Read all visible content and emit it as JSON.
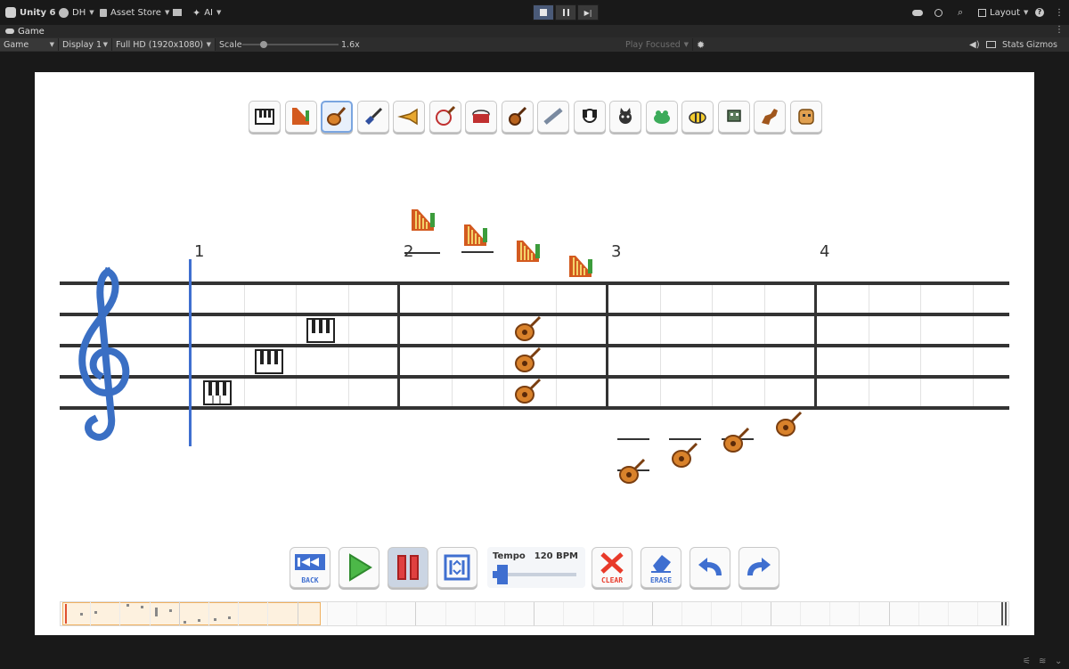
{
  "editor": {
    "unity_label": "Unity 6",
    "account_label": "DH",
    "asset_store_label": "Asset Store",
    "ai_label": "AI",
    "layout_label": "Layout",
    "game_tab_label": "Game",
    "game_view_dropdown": "Game",
    "display_dropdown": "Display 1",
    "resolution_dropdown": "Full HD (1920x1080)",
    "scale_label": "Scale",
    "scale_value": "1.6x",
    "play_focused_dropdown": "Play Focused",
    "stats_label": "Stats",
    "gizmos_label": "Gizmos"
  },
  "instruments": [
    {
      "name": "piano-icon",
      "selected": false
    },
    {
      "name": "harp-icon",
      "selected": false
    },
    {
      "name": "lute-icon",
      "selected": true
    },
    {
      "name": "electric-guitar-icon",
      "selected": false
    },
    {
      "name": "trumpet-icon",
      "selected": false
    },
    {
      "name": "banjo-icon",
      "selected": false
    },
    {
      "name": "drum-icon",
      "selected": false
    },
    {
      "name": "violin-icon",
      "selected": false
    },
    {
      "name": "flute-icon",
      "selected": false
    },
    {
      "name": "dog-icon",
      "selected": false
    },
    {
      "name": "cat-icon",
      "selected": false
    },
    {
      "name": "frog-icon",
      "selected": false
    },
    {
      "name": "bee-icon",
      "selected": false
    },
    {
      "name": "robot-icon",
      "selected": false
    },
    {
      "name": "dinosaur-icon",
      "selected": false
    },
    {
      "name": "ghost-icon",
      "selected": false
    }
  ],
  "score": {
    "measures": [
      "1",
      "2",
      "3",
      "4"
    ]
  },
  "controls": {
    "back_label": "BACK",
    "clear_label": "CLEAR",
    "erase_label": "ERASE",
    "tempo_label": "Tempo",
    "tempo_value": "120 BPM",
    "tempo_level_fraction": 0.12
  },
  "colors": {
    "accent_blue": "#3f6fd0",
    "clear_red": "#e83a2a",
    "pause_red": "#e04040",
    "play_green": "#4cb848"
  }
}
